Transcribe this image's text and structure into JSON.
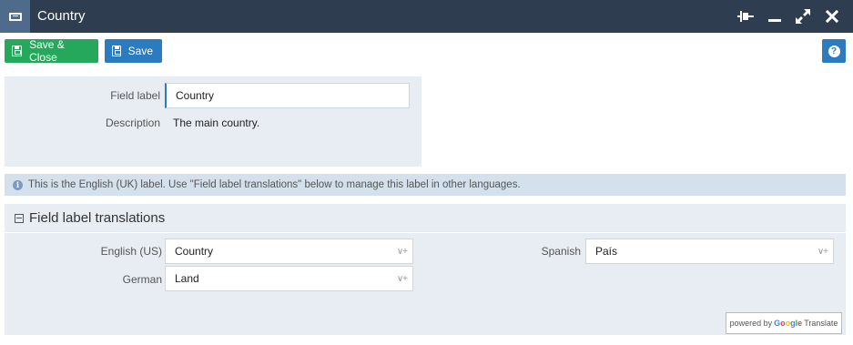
{
  "window": {
    "title": "Country",
    "controls": [
      "pin-icon",
      "minimize-icon",
      "maximize-icon",
      "close-icon"
    ]
  },
  "toolbar": {
    "save_close_label": "Save & Close",
    "save_label": "Save",
    "help_label": "?"
  },
  "field": {
    "label_caption": "Field label",
    "label_value": "Country",
    "description_caption": "Description",
    "description_value": "The main country."
  },
  "info": {
    "text": "This is the English (UK) label. Use \"Field label translations\" below to manage this label in other languages."
  },
  "translations": {
    "title": "Field label translations",
    "items": [
      {
        "language": "English (US)",
        "value": "Country"
      },
      {
        "language": "German",
        "value": "Land"
      },
      {
        "language": "Spanish",
        "value": "País"
      }
    ],
    "powered_by": "powered by",
    "google": "Google",
    "translate": "Translate"
  },
  "colors": {
    "titlebar": "#2e3e50",
    "save_close": "#25a85b",
    "save": "#2a7bbf",
    "panel": "#e8edf3",
    "infobar": "#d4e0ec"
  }
}
